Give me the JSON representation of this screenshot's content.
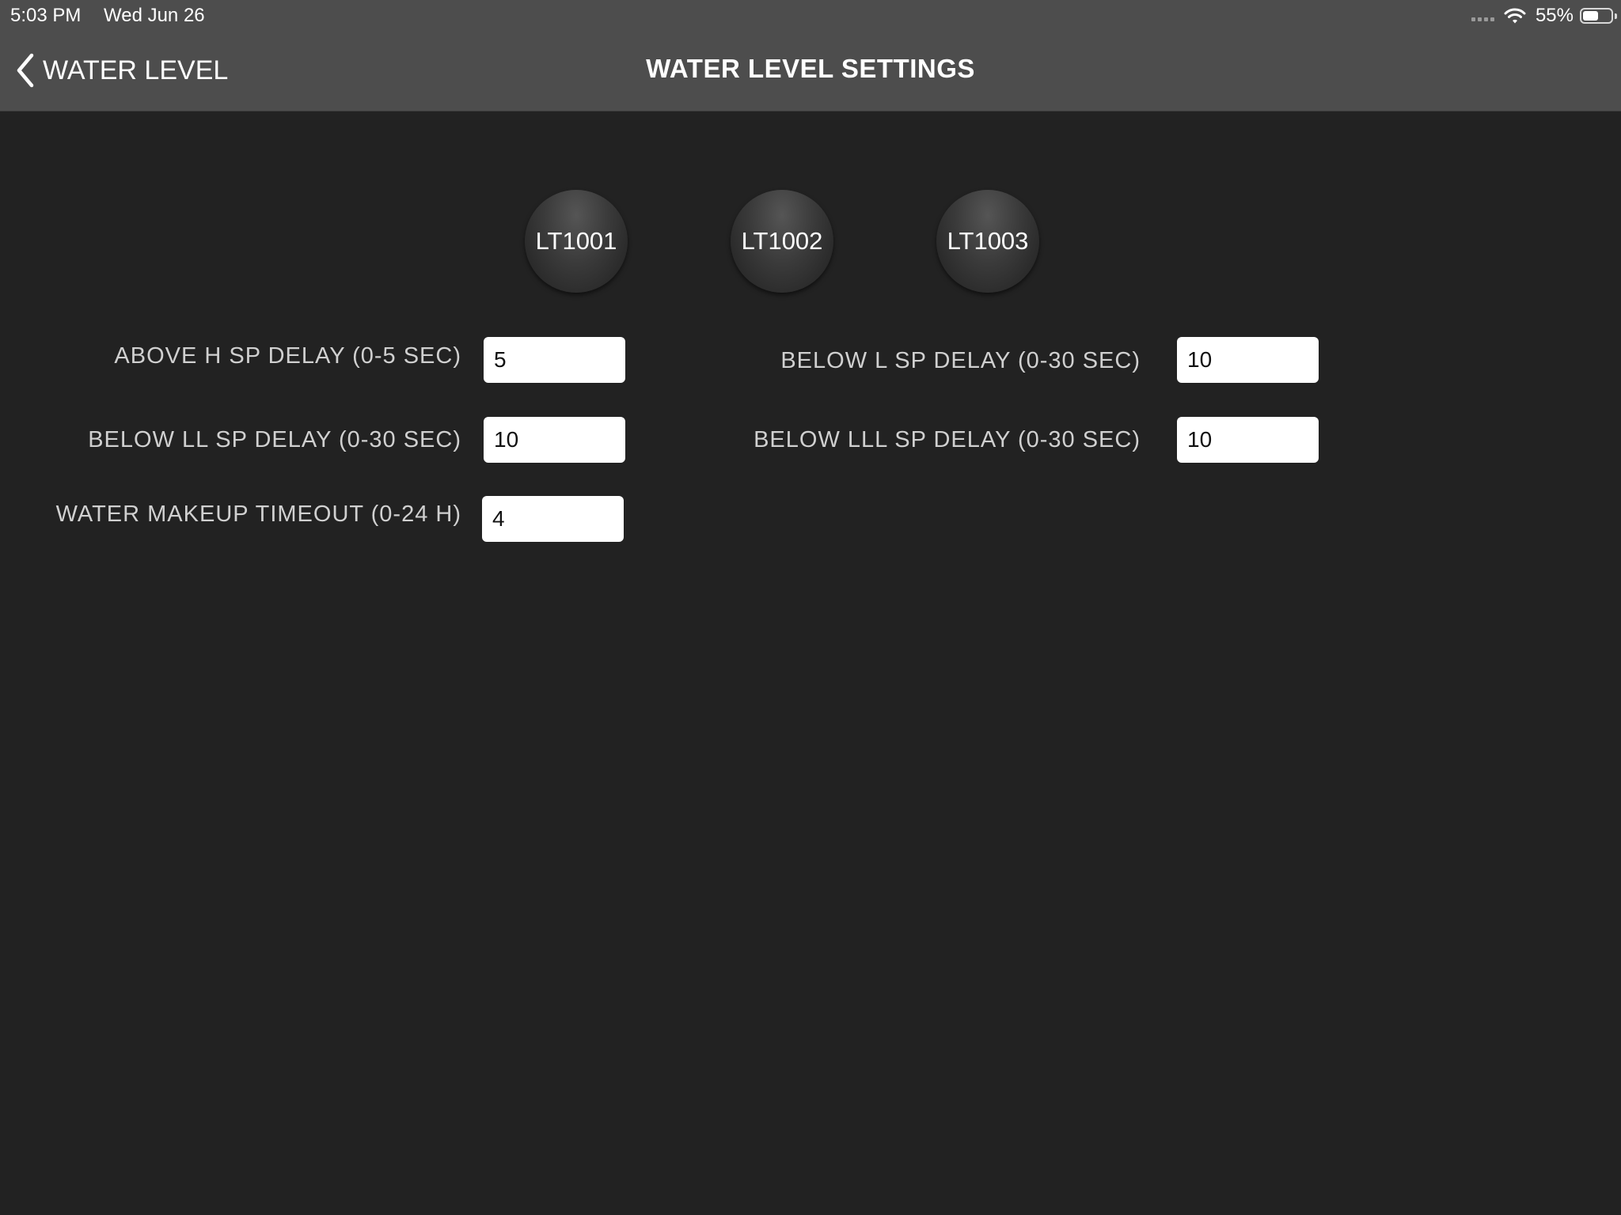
{
  "status_bar": {
    "time": "5:03 PM",
    "date": "Wed Jun 26",
    "battery_percent": "55%",
    "battery_level": 0.55,
    "icons": [
      "signal-dots-icon",
      "wifi-icon",
      "battery-icon"
    ]
  },
  "nav": {
    "back_label": "WATER LEVEL",
    "title": "WATER LEVEL SETTINGS"
  },
  "sensors": [
    {
      "label": "LT1001"
    },
    {
      "label": "LT1002"
    },
    {
      "label": "LT1003"
    }
  ],
  "fields": {
    "above_h_sp_delay": {
      "label": "ABOVE H SP DELAY (0-5 SEC)",
      "value": "5"
    },
    "below_ll_sp_delay": {
      "label": "BELOW LL SP DELAY (0-30 SEC)",
      "value": "10"
    },
    "water_makeup_timeout": {
      "label": "WATER MAKEUP TIMEOUT (0-24 H)",
      "value": "4"
    },
    "below_l_sp_delay": {
      "label": "BELOW L SP DELAY (0-30 SEC)",
      "value": "10"
    },
    "below_lll_sp_delay": {
      "label": "BELOW LLL SP DELAY (0-30 SEC)",
      "value": "10"
    }
  },
  "colors": {
    "background": "#222222",
    "bar": "#4d4d4d",
    "label_text": "#d0d0d0",
    "input_bg": "#ffffff"
  }
}
